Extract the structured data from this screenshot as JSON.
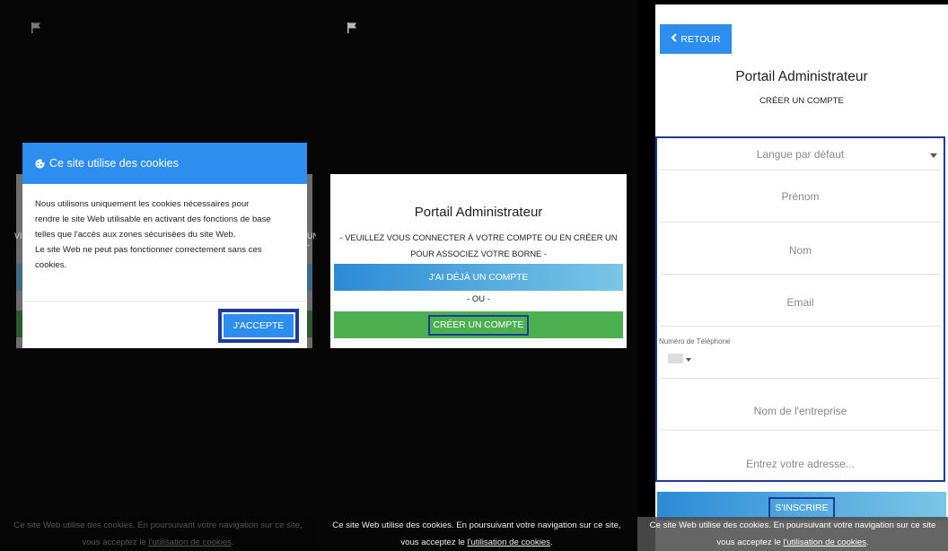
{
  "panel1": {
    "side_left": "VI",
    "side_right": "UN -",
    "cookie_modal": {
      "title": "Ce site utilise des cookies",
      "body_lines": [
        "Nous utilisons uniquement les cookies nécessaires pour",
        "rendre le site Web utilisable en activant des fonctions de base",
        "telles que l'accès aux zones sécurisées du site Web.",
        "Le site Web ne peut pas fonctionner correctement sans ces",
        "cookies."
      ],
      "accept_label": "J'ACCEPTE"
    },
    "banner": {
      "line1": "Ce site Web utilise des cookies. En poursuivant votre navigation sur ce site,",
      "line2_prefix": "vous acceptez le ",
      "link": "l'utilisation de cookies",
      "line2_suffix": "."
    }
  },
  "panel2": {
    "title": "Portail Administrateur",
    "subtitle_line1": "- VEUILLEZ VOUS CONNECTER À VOTRE COMPTE OU EN CRÉER UN",
    "subtitle_line2": "POUR ASSOCIEZ VOTRE BORNE -",
    "have_account_label": "J'AI DÉJÀ UN COMPTE",
    "or_label": "- OU -",
    "create_account_label": "CRÉER UN COMPTE",
    "banner": {
      "line1": "Ce site Web utilise des cookies. En poursuivant votre navigation sur ce site,",
      "line2_prefix": "vous acceptez le ",
      "link": "l'utilisation de cookies",
      "line2_suffix": "."
    }
  },
  "panel3": {
    "back_label": "RETOUR",
    "title": "Portail Administrateur",
    "subtitle": "CRÉER UN COMPTE",
    "fields": {
      "language": "Langue par défaut",
      "first_name": "Prénom",
      "last_name": "Nom",
      "email": "Email",
      "phone_label": "Numéro de Téléphone",
      "company": "Nom de l'entreprise",
      "address": "Entrez votre adresse..."
    },
    "signup_label": "S'INSCRIRE",
    "banner": {
      "line1": "Ce site Web utilise des cookies. En poursuivant votre navigation sur ce site",
      "line2_prefix": "vous acceptez le ",
      "link": "l'utilisation de cookies",
      "line2_suffix": "."
    }
  }
}
